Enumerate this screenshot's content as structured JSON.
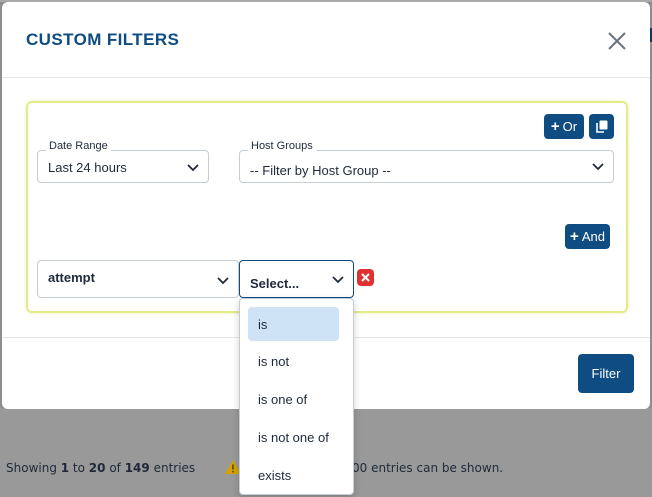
{
  "background": {
    "showing": {
      "prefix": "Showing ",
      "from": "1",
      "to_word": " to ",
      "to": "20",
      "of_word": " of ",
      "total": "149",
      "suffix": " entries"
    },
    "limit_text": "00 entries can be shown."
  },
  "modal": {
    "title": "CUSTOM FILTERS",
    "or_label": "Or",
    "and_label": "And",
    "filter_label": "Filter",
    "date_range": {
      "label": "Date Range",
      "value": "Last 24 hours"
    },
    "host_groups": {
      "label": "Host Groups",
      "value": "-- Filter by Host Group --"
    },
    "field_select": {
      "value": "attempt"
    },
    "operator_select": {
      "value": "Select..."
    },
    "operator_options": [
      {
        "label": "is",
        "active": true
      },
      {
        "label": "is not",
        "active": false
      },
      {
        "label": "is one of",
        "active": false
      },
      {
        "label": "is not one of",
        "active": false
      },
      {
        "label": "exists",
        "active": false
      }
    ]
  },
  "colors": {
    "accent": "#0f4c81",
    "danger": "#e03131",
    "box_border": "#e4ec8a",
    "highlight": "#cfe3f7"
  }
}
